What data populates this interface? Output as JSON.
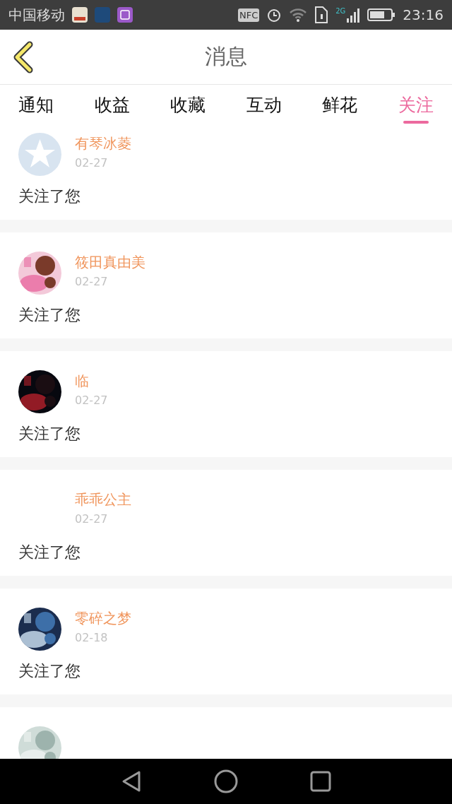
{
  "status_bar": {
    "carrier": "中国移动",
    "nfc": "NFC",
    "network": "2G",
    "time": "23:16"
  },
  "header": {
    "title": "消息"
  },
  "tabs": [
    {
      "label": "通知",
      "selected": false
    },
    {
      "label": "收益",
      "selected": false
    },
    {
      "label": "收藏",
      "selected": false
    },
    {
      "label": "互动",
      "selected": false
    },
    {
      "label": "鲜花",
      "selected": false
    },
    {
      "label": "关注",
      "selected": true
    }
  ],
  "messages": [
    {
      "name": "有琴冰菱",
      "date": "02-27",
      "text": "关注了您",
      "kind": "default"
    },
    {
      "name": "筱田真由美",
      "date": "02-27",
      "text": "关注了您",
      "kind": "picture"
    },
    {
      "name": "临",
      "date": "02-27",
      "text": "关注了您",
      "kind": "picture"
    },
    {
      "name": "乖乖公主",
      "date": "02-27",
      "text": "关注了您",
      "kind": "blank"
    },
    {
      "name": "零碎之梦",
      "date": "02-18",
      "text": "关注了您",
      "kind": "picture"
    },
    {
      "kind": "picture"
    }
  ]
}
